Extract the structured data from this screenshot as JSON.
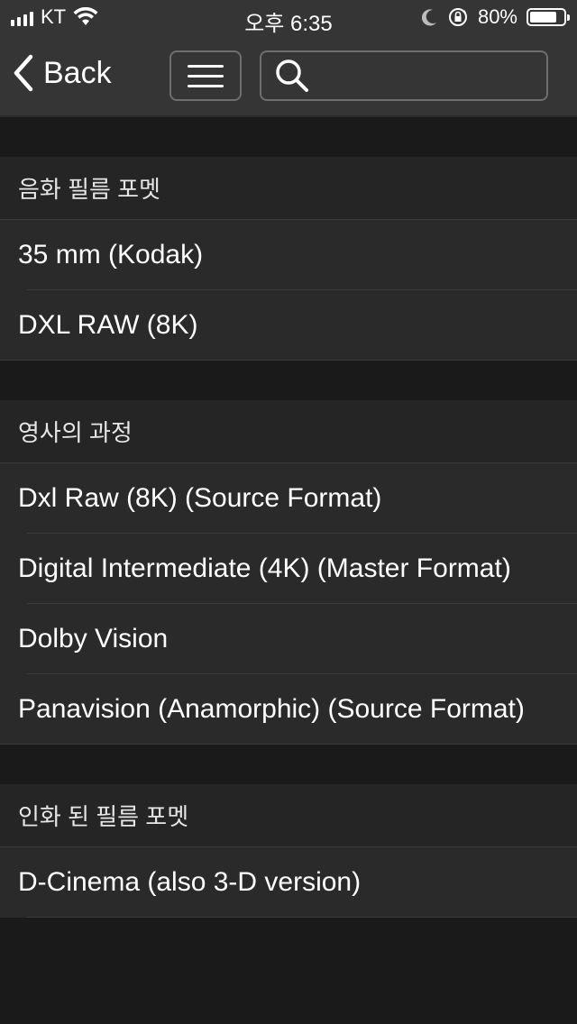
{
  "status_bar": {
    "carrier": "KT",
    "time": "오후 6:35",
    "battery_percent": "80%",
    "battery_level": 0.8,
    "icons": [
      "signal-icon",
      "wifi-icon",
      "moon-icon",
      "rotation-lock-icon",
      "battery-icon"
    ]
  },
  "nav": {
    "back_label": "Back",
    "menu_icon": "hamburger-icon",
    "search_icon": "search-icon",
    "search_value": ""
  },
  "sections": [
    {
      "header": "음화 필름 포멧",
      "items": [
        "35 mm (Kodak)",
        "DXL RAW (8K)"
      ]
    },
    {
      "header": "영사의 과정",
      "items": [
        "Dxl Raw (8K) (Source Format)",
        "Digital Intermediate (4K) (Master Format)",
        "Dolby Vision",
        "Panavision (Anamorphic) (Source Format)"
      ]
    },
    {
      "header": "인화 된 필름 포멧",
      "items": [
        "D-Cinema (also 3-D version)"
      ]
    }
  ],
  "colors": {
    "bar_bg": "#353535",
    "section_bg": "#252525",
    "row_bg": "#2a2a2a",
    "gap_bg": "#1a1a1a"
  }
}
